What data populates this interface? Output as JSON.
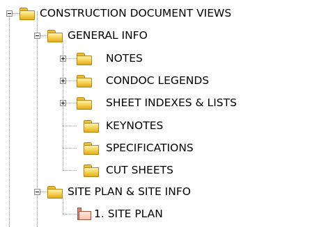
{
  "tree": {
    "root": {
      "label": "CONSTRUCTION DOCUMENT VIEWS",
      "icon": "folder-icon",
      "expanded": true
    },
    "general_info": {
      "label": "GENERAL INFO",
      "icon": "folder-icon",
      "expanded": true,
      "children": [
        {
          "label": "NOTES",
          "icon": "folder-icon",
          "expandable": true
        },
        {
          "label": "CONDOC LEGENDS",
          "icon": "folder-icon",
          "expandable": true
        },
        {
          "label": "SHEET INDEXES & LISTS",
          "icon": "folder-icon",
          "expandable": true
        },
        {
          "label": "KEYNOTES",
          "icon": "folder-icon",
          "expandable": false
        },
        {
          "label": "SPECIFICATIONS",
          "icon": "folder-icon",
          "expandable": false
        },
        {
          "label": "CUT SHEETS",
          "icon": "folder-icon",
          "expandable": false
        }
      ]
    },
    "site_plan": {
      "label": "SITE PLAN & SITE INFO",
      "icon": "folder-icon",
      "expanded": true,
      "children": [
        {
          "label": "1. SITE PLAN",
          "icon": "sheet-view-icon"
        }
      ]
    }
  }
}
